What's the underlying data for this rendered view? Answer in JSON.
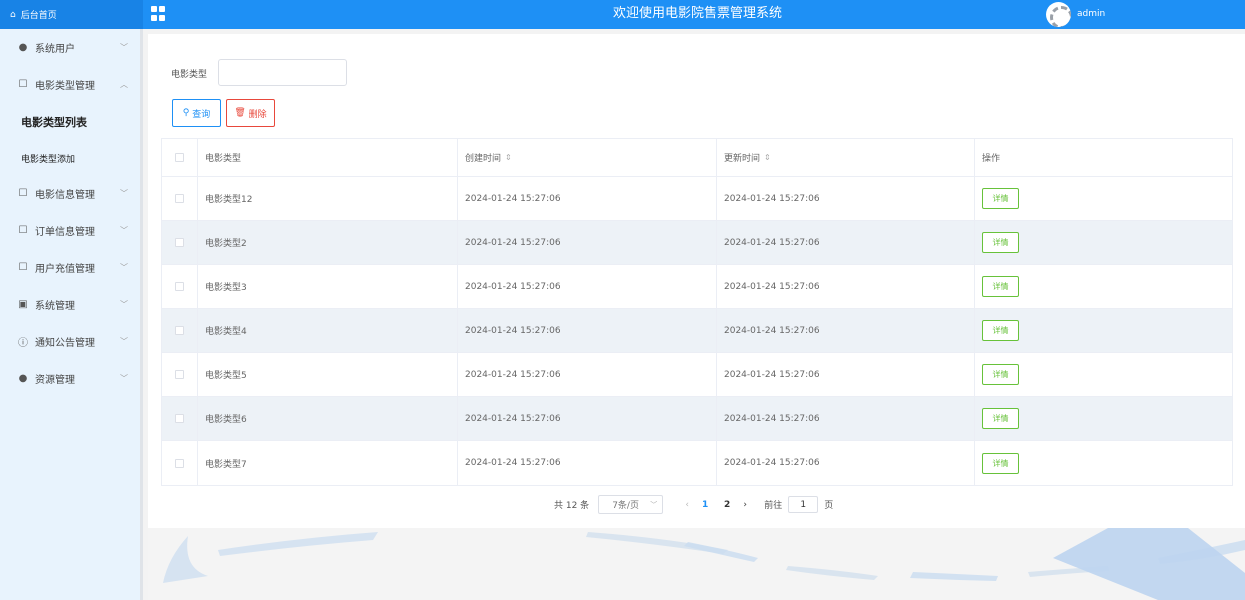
{
  "header": {
    "brand_label": "后台首页",
    "title": "欢迎使用电影院售票管理系统",
    "username": "admin",
    "colors": {
      "primary": "#1e90f5",
      "brand_bg": "#1883e6"
    }
  },
  "sidebar": {
    "items": [
      {
        "label": "系统用户",
        "icon": "user-icon"
      },
      {
        "label": "电影类型管理",
        "icon": "external-link-icon"
      },
      {
        "label": "电影信息管理",
        "icon": "external-link-icon"
      },
      {
        "label": "订单信息管理",
        "icon": "external-link-icon"
      },
      {
        "label": "用户充值管理",
        "icon": "external-link-icon"
      },
      {
        "label": "系统管理",
        "icon": "picture-icon"
      },
      {
        "label": "通知公告管理",
        "icon": "info-circle-icon"
      },
      {
        "label": "资源管理",
        "icon": "bulb-icon"
      }
    ],
    "sub_items": [
      {
        "label": "电影类型列表",
        "active": true
      },
      {
        "label": "电影类型添加",
        "active": false
      }
    ]
  },
  "filter": {
    "label": "电影类型",
    "value": "",
    "query_label": "查询",
    "delete_label": "删除"
  },
  "table": {
    "columns": [
      "电影类型",
      "创建时间",
      "更新时间",
      "操作"
    ],
    "rows": [
      {
        "type": "电影类型12",
        "created": "2024-01-24 15:27:06",
        "updated": "2024-01-24 15:27:06",
        "action": "详情"
      },
      {
        "type": "电影类型2",
        "created": "2024-01-24 15:27:06",
        "updated": "2024-01-24 15:27:06",
        "action": "详情"
      },
      {
        "type": "电影类型3",
        "created": "2024-01-24 15:27:06",
        "updated": "2024-01-24 15:27:06",
        "action": "详情"
      },
      {
        "type": "电影类型4",
        "created": "2024-01-24 15:27:06",
        "updated": "2024-01-24 15:27:06",
        "action": "详情"
      },
      {
        "type": "电影类型5",
        "created": "2024-01-24 15:27:06",
        "updated": "2024-01-24 15:27:06",
        "action": "详情"
      },
      {
        "type": "电影类型6",
        "created": "2024-01-24 15:27:06",
        "updated": "2024-01-24 15:27:06",
        "action": "详情"
      },
      {
        "type": "电影类型7",
        "created": "2024-01-24 15:27:06",
        "updated": "2024-01-24 15:27:06",
        "action": "详情"
      }
    ]
  },
  "pagination": {
    "total": "共 12 条",
    "page_size": "7条/页",
    "pages": [
      "1",
      "2"
    ],
    "current_page": "1",
    "goto_prefix": "前往",
    "goto_value": "1",
    "goto_suffix": "页"
  }
}
